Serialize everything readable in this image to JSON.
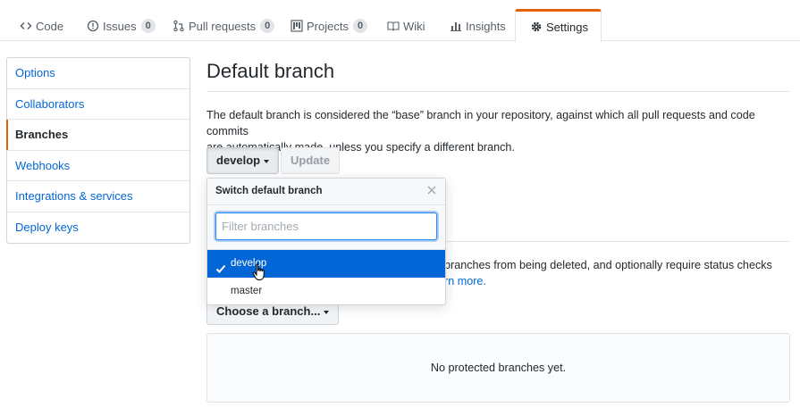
{
  "repo_nav": {
    "tabs": [
      {
        "label": "Code",
        "icon": "code-icon"
      },
      {
        "label": "Issues",
        "icon": "issue-opened-icon",
        "count": "0"
      },
      {
        "label": "Pull requests",
        "icon": "git-pull-request-icon",
        "count": "0"
      },
      {
        "label": "Projects",
        "icon": "project-icon",
        "count": "0"
      },
      {
        "label": "Wiki",
        "icon": "book-icon"
      },
      {
        "label": "Insights",
        "icon": "graph-icon"
      },
      {
        "label": "Settings",
        "icon": "gear-icon",
        "selected": true
      }
    ]
  },
  "sidebar": {
    "items": [
      {
        "label": "Options"
      },
      {
        "label": "Collaborators"
      },
      {
        "label": "Branches",
        "selected": true
      },
      {
        "label": "Webhooks"
      },
      {
        "label": "Integrations & services"
      },
      {
        "label": "Deploy keys"
      }
    ]
  },
  "main": {
    "title": "Default branch",
    "description_line1": "The default branch is considered the “base” branch in your repository, against which all pull requests and code commits",
    "description_line2": "are automatically made, unless you specify a different branch.",
    "branch_button_label": "develop",
    "update_button_label": "Update",
    "protected_text": "t branches from being deleted, and optionally require status checks",
    "protected_link": "rn more.",
    "choose_branch_label": "Choose a branch...",
    "empty_state": "No protected branches yet."
  },
  "dropdown": {
    "title": "Switch default branch",
    "filter_placeholder": "Filter branches",
    "filter_value": "",
    "items": [
      {
        "label": "develop",
        "selected": true
      },
      {
        "label": "master",
        "selected": false
      }
    ]
  },
  "colors": {
    "accent_orange": "#e36209",
    "link_blue": "#0366d6",
    "selected_blue": "#0366d6"
  }
}
